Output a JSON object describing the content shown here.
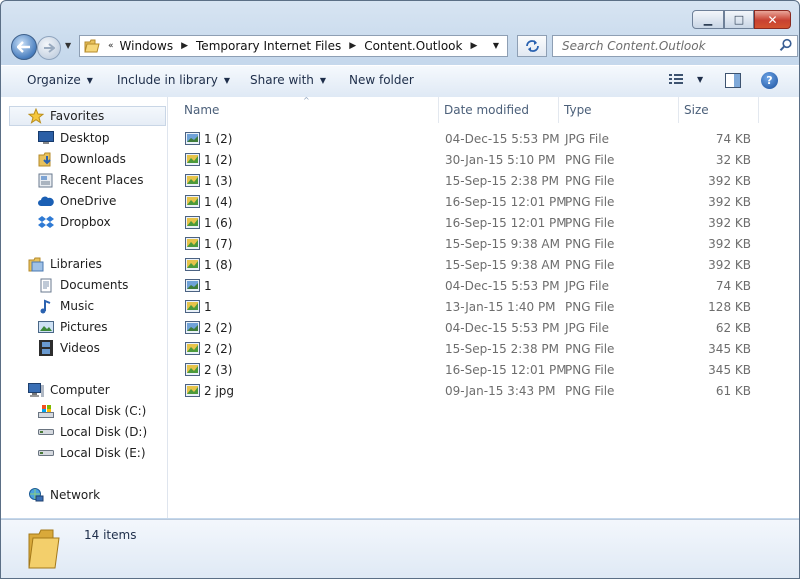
{
  "window": {
    "caption": {
      "minimize_glyph": "▁",
      "maximize_glyph": "□",
      "close_glyph": "✕"
    }
  },
  "nav": {
    "recent_glyph": "▼",
    "breadcrumb_prefix": "«",
    "breadcrumb": [
      "Windows",
      "Temporary Internet Files",
      "Content.Outlook"
    ],
    "address_dropdown_glyph": "▼",
    "search_placeholder": "Search Content.Outlook"
  },
  "toolbar": {
    "organize": "Organize",
    "include_in_library": "Include in library",
    "share_with": "Share with",
    "new_folder": "New folder",
    "help_glyph": "?"
  },
  "sidebar": {
    "favorites": "Favorites",
    "favorites_items": [
      "Desktop",
      "Downloads",
      "Recent Places",
      "OneDrive",
      "Dropbox"
    ],
    "libraries": "Libraries",
    "libraries_items": [
      "Documents",
      "Music",
      "Pictures",
      "Videos"
    ],
    "computer": "Computer",
    "computer_items": [
      "Local Disk (C:)",
      "Local Disk (D:)",
      "Local Disk (E:)"
    ],
    "network": "Network"
  },
  "columns": {
    "name": "Name",
    "date": "Date modified",
    "type": "Type",
    "size": "Size"
  },
  "files": [
    {
      "name": "1 (2)",
      "date": "04-Dec-15 5:53 PM",
      "type": "JPG File",
      "size": "74 KB",
      "icon": "jpg"
    },
    {
      "name": "1 (2)",
      "date": "30-Jan-15 5:10 PM",
      "type": "PNG File",
      "size": "32 KB",
      "icon": "png"
    },
    {
      "name": "1 (3)",
      "date": "15-Sep-15 2:38 PM",
      "type": "PNG File",
      "size": "392 KB",
      "icon": "png"
    },
    {
      "name": "1 (4)",
      "date": "16-Sep-15 12:01 PM",
      "type": "PNG File",
      "size": "392 KB",
      "icon": "png"
    },
    {
      "name": "1 (6)",
      "date": "16-Sep-15 12:01 PM",
      "type": "PNG File",
      "size": "392 KB",
      "icon": "png"
    },
    {
      "name": "1 (7)",
      "date": "15-Sep-15 9:38 AM",
      "type": "PNG File",
      "size": "392 KB",
      "icon": "png"
    },
    {
      "name": "1 (8)",
      "date": "15-Sep-15 9:38 AM",
      "type": "PNG File",
      "size": "392 KB",
      "icon": "png"
    },
    {
      "name": "1",
      "date": "04-Dec-15 5:53 PM",
      "type": "JPG File",
      "size": "74 KB",
      "icon": "jpg"
    },
    {
      "name": "1",
      "date": "13-Jan-15 1:40 PM",
      "type": "PNG File",
      "size": "128 KB",
      "icon": "png"
    },
    {
      "name": "2 (2)",
      "date": "04-Dec-15 5:53 PM",
      "type": "JPG File",
      "size": "62 KB",
      "icon": "jpg"
    },
    {
      "name": "2 (2)",
      "date": "15-Sep-15 2:38 PM",
      "type": "PNG File",
      "size": "345 KB",
      "icon": "png"
    },
    {
      "name": "2 (3)",
      "date": "16-Sep-15 12:01 PM",
      "type": "PNG File",
      "size": "345 KB",
      "icon": "png"
    },
    {
      "name": "2 jpg",
      "date": "09-Jan-15 3:43 PM",
      "type": "PNG File",
      "size": "61 KB",
      "icon": "png"
    }
  ],
  "details": {
    "item_count": "14 items"
  }
}
